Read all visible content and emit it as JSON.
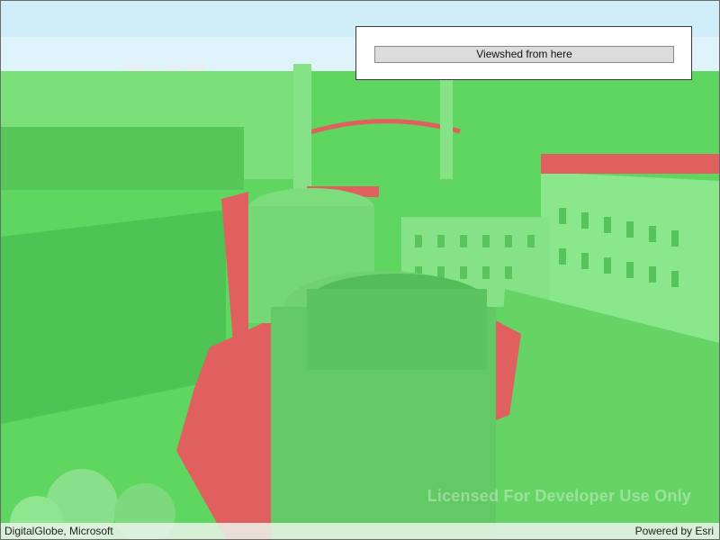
{
  "viewshed_panel": {
    "button_label": "Viewshed from here"
  },
  "watermark": {
    "text": "Licensed For Developer Use Only"
  },
  "attribution": {
    "left": "DigitalGlobe, Microsoft",
    "right": "Powered by Esri"
  },
  "colors": {
    "visible": "#5fd65f",
    "obstructed": "#e06060",
    "sky": "#d9f0f9"
  }
}
